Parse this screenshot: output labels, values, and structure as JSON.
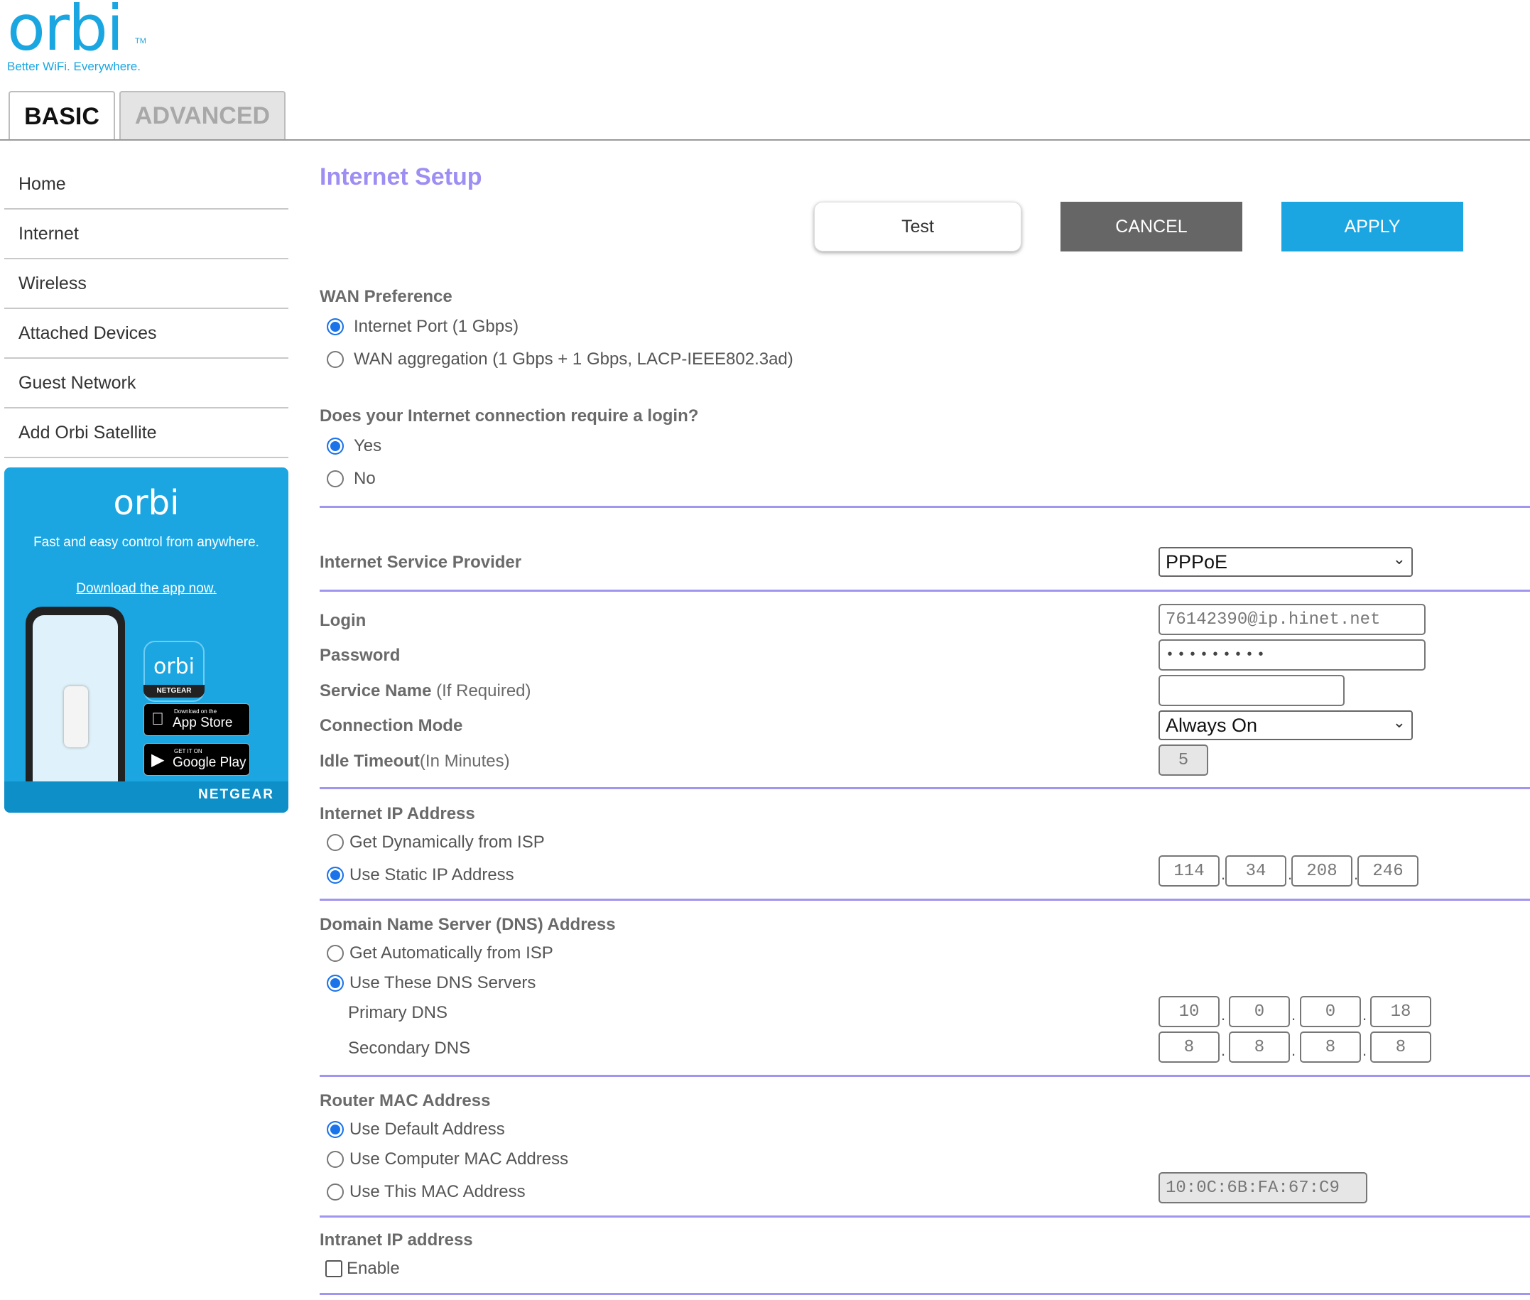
{
  "brand": {
    "logo_text": "orbi",
    "tm": "TM",
    "tagline": "Better WiFi. Everywhere."
  },
  "tabs": [
    {
      "label": "BASIC",
      "active": true
    },
    {
      "label": "ADVANCED",
      "active": false
    }
  ],
  "sidebar": {
    "items": [
      {
        "label": "Home"
      },
      {
        "label": "Internet"
      },
      {
        "label": "Wireless"
      },
      {
        "label": "Attached Devices"
      },
      {
        "label": "Guest Network"
      },
      {
        "label": "Add Orbi Satellite"
      }
    ]
  },
  "promo": {
    "logo_text": "orbi",
    "text": "Fast and easy control from anywhere.",
    "link": "Download the app now.",
    "app_icon_text": "orbi",
    "app_icon_band": "NETGEAR",
    "app_store_small": "Download on the",
    "app_store_big": "App Store",
    "google_play_small": "GET IT ON",
    "google_play_big": "Google Play",
    "brand": "NETGEAR"
  },
  "page": {
    "title": "Internet Setup"
  },
  "buttons": {
    "test": "Test",
    "cancel": "CANCEL",
    "apply": "APPLY"
  },
  "wan": {
    "heading": "WAN Preference",
    "options": [
      "Internet Port (1 Gbps)",
      "WAN aggregation (1 Gbps + 1 Gbps, LACP-IEEE802.3ad)"
    ],
    "selected": 0
  },
  "login_required": {
    "heading": "Does your Internet connection require a login?",
    "options": [
      "Yes",
      "No"
    ],
    "selected": 0
  },
  "isp": {
    "label": "Internet Service Provider",
    "value": "PPPoE"
  },
  "login": {
    "label": "Login",
    "value": "76142390@ip.hinet.net"
  },
  "password": {
    "label": "Password",
    "value": "•••••••••"
  },
  "service_name": {
    "label": "Service Name",
    "hint": " (If Required)",
    "value": ""
  },
  "connection_mode": {
    "label": "Connection Mode",
    "value": "Always On"
  },
  "idle_timeout": {
    "label": "Idle Timeout",
    "hint": "(In Minutes)",
    "value": "5"
  },
  "internet_ip": {
    "heading": "Internet IP Address",
    "options": [
      "Get Dynamically from ISP",
      "Use Static IP Address"
    ],
    "selected": 1,
    "octets": [
      "114",
      "34",
      "208",
      "246"
    ]
  },
  "dns": {
    "heading": "Domain Name Server (DNS) Address",
    "options": [
      "Get Automatically from ISP",
      "Use These DNS Servers"
    ],
    "selected": 1,
    "primary_label": "Primary DNS",
    "primary": [
      "10",
      "0",
      "0",
      "18"
    ],
    "secondary_label": "Secondary DNS",
    "secondary": [
      "8",
      "8",
      "8",
      "8"
    ]
  },
  "mac": {
    "heading": "Router MAC Address",
    "options": [
      "Use Default Address",
      "Use Computer MAC Address",
      "Use This MAC Address"
    ],
    "selected": 0,
    "value": "10:0C:6B:FA:67:C9"
  },
  "intranet": {
    "heading": "Intranet IP address",
    "checkbox_label": "Enable",
    "checked": false
  },
  "colors": {
    "brand_blue": "#1ba6e2",
    "title_purple": "#9d8ef4",
    "separator": "#a095ef",
    "cancel_gray": "#666666"
  }
}
